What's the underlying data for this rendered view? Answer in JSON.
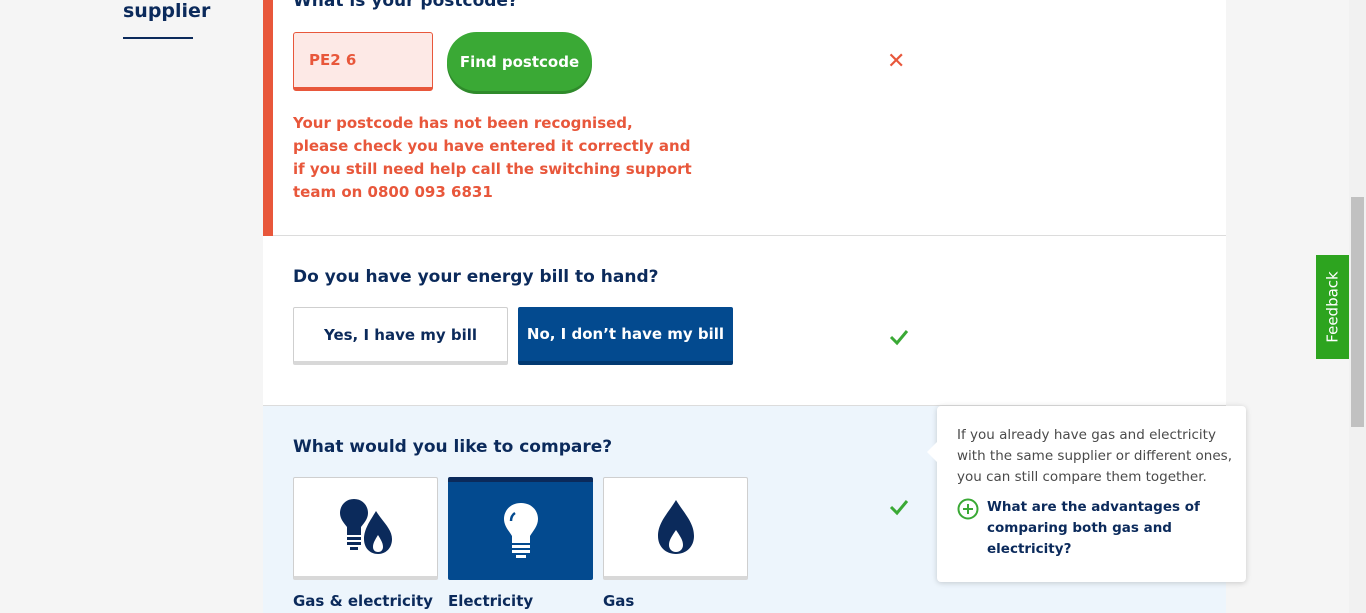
{
  "sidebar": {
    "title": "supplier"
  },
  "postcode": {
    "question": "What is your postcode?",
    "input_value": "PE2 6",
    "find_button_label": "Find postcode",
    "error_message": "Your postcode has not been recognised, please check you have entered it correctly and if you still need help call the switching support team on 0800 093 6831",
    "status_icon": "cross-icon"
  },
  "bill": {
    "question": "Do you have your energy bill to hand?",
    "options": [
      {
        "label": "Yes, I have my bill",
        "selected": false
      },
      {
        "label": "No, I don’t have my bill",
        "selected": true
      }
    ],
    "status_icon": "check-icon"
  },
  "compare": {
    "question": "What would you like to compare?",
    "options": [
      {
        "label": "Gas & electricity",
        "icon": "bulb-and-flame-icon",
        "selected": false
      },
      {
        "label": "Electricity",
        "icon": "bulb-icon",
        "selected": true
      },
      {
        "label": "Gas",
        "icon": "flame-icon",
        "selected": false
      }
    ],
    "status_icon": "check-icon"
  },
  "tooltip": {
    "text": "If you already have gas and electricity with the same supplier or different ones, you can still compare them together.",
    "link_label": "What are the advantages of comparing both gas and electricity?",
    "link_icon": "plus-circle-icon"
  },
  "feedback": {
    "label": "Feedback"
  },
  "colors": {
    "navy": "#0b2a5b",
    "selected_blue": "#034a8f",
    "green": "#3aa935",
    "error_red": "#e8573b",
    "feedback_green": "#2da41f",
    "compare_bg": "#edf5fc"
  }
}
